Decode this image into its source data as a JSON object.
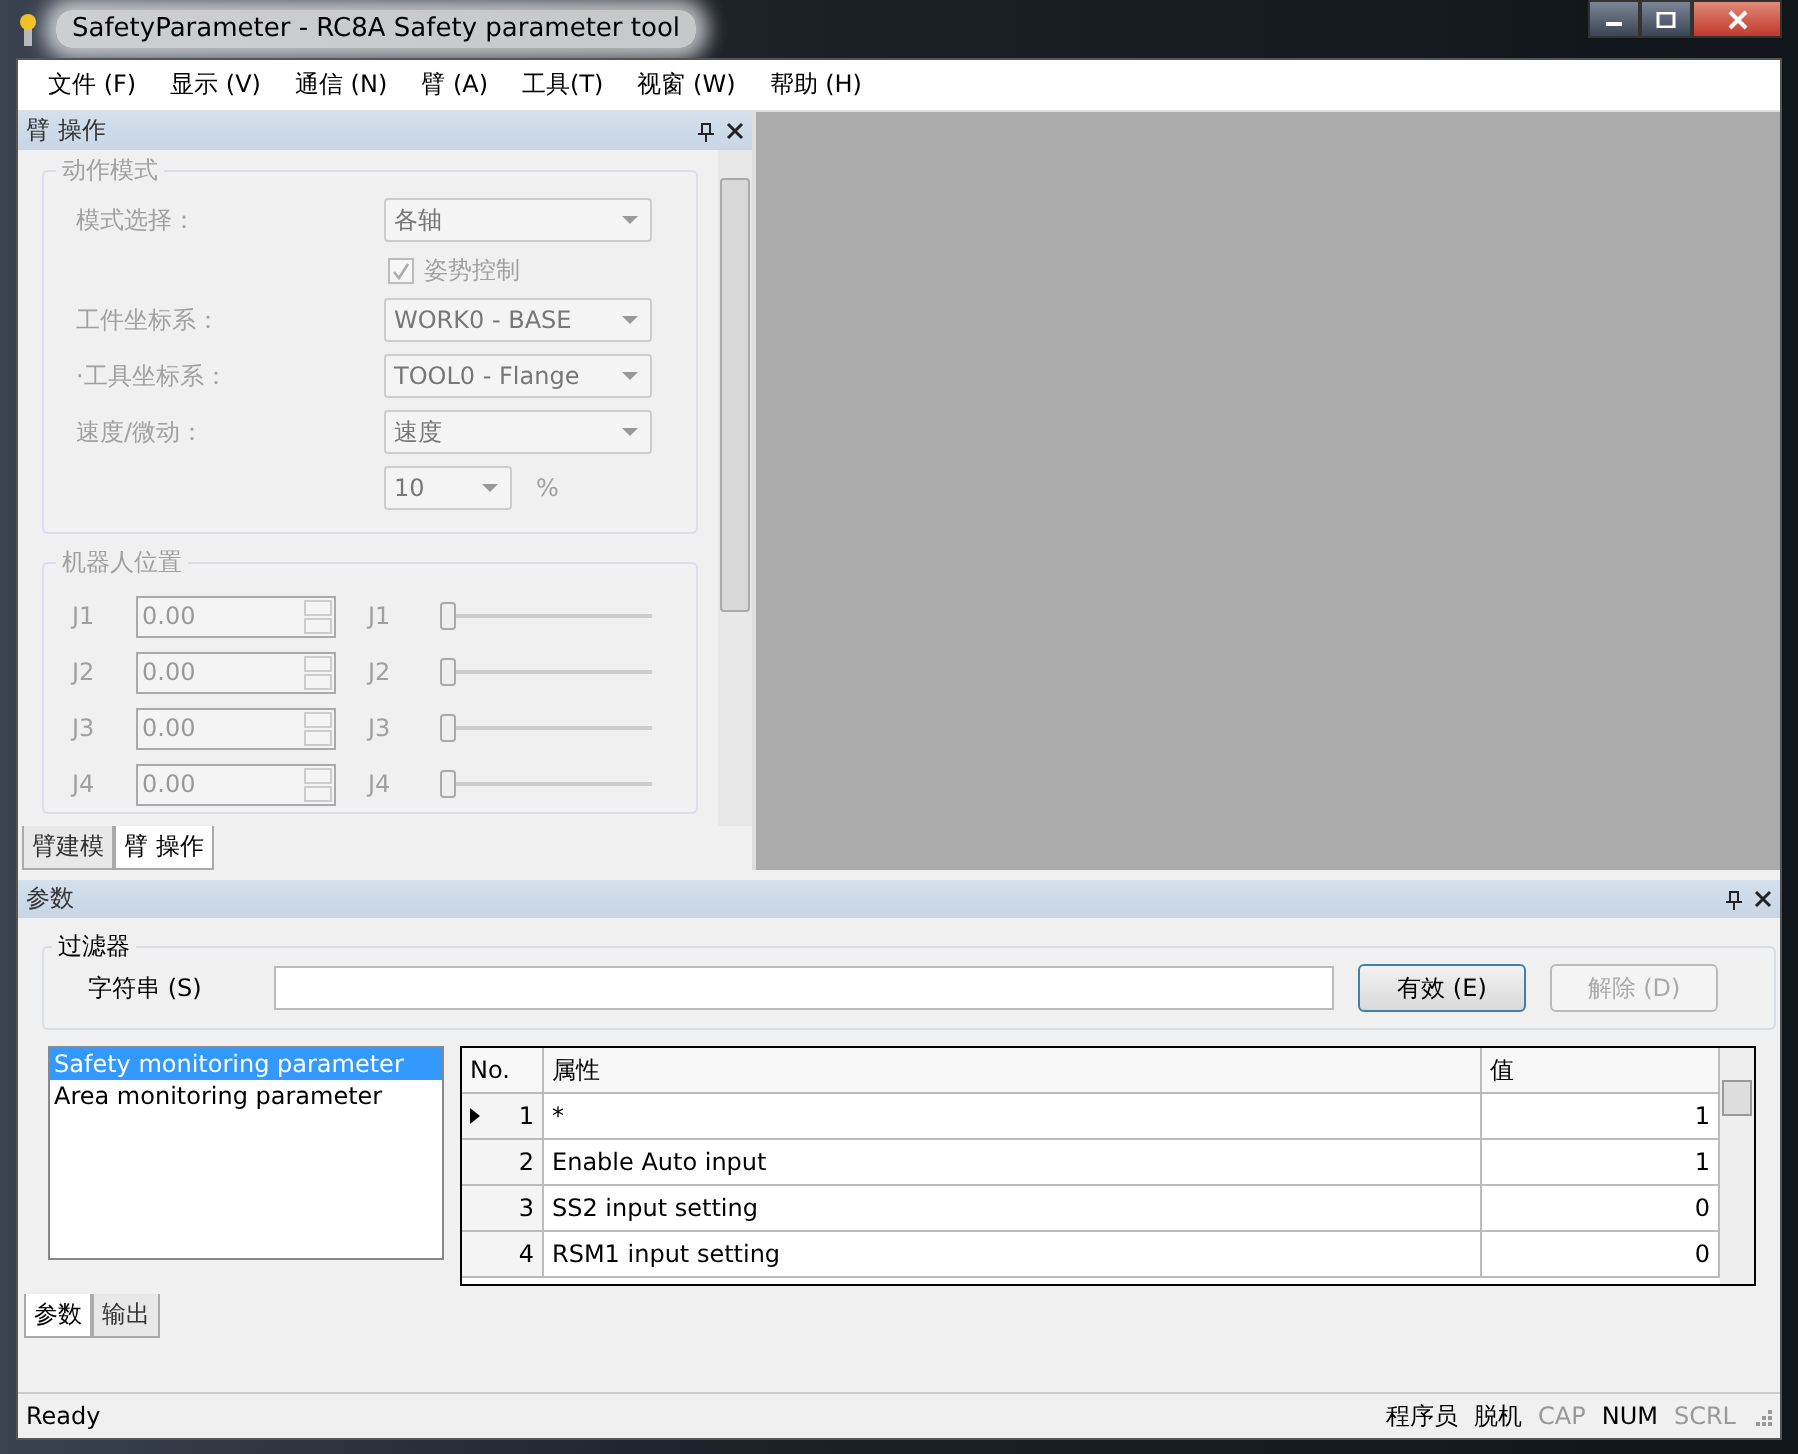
{
  "window": {
    "title": "SafetyParameter - RC8A Safety parameter tool"
  },
  "menu": [
    "文件 (F)",
    "显示 (V)",
    "通信 (N)",
    "臂 (A)",
    "工具(T)",
    "视窗 (W)",
    "帮助 (H)"
  ],
  "arm_panel": {
    "title": "臂 操作",
    "disabled": true,
    "motion_group": {
      "title": "动作模式",
      "fields": [
        {
          "kind": "dropdown",
          "label": "模式选择：",
          "value": "各轴"
        },
        {
          "kind": "checkbox",
          "label": "姿势控制",
          "checked": true
        },
        {
          "kind": "dropdown",
          "label": "工件坐标系：",
          "value": "WORK0 - BASE"
        },
        {
          "kind": "dropdown",
          "label": "·工具坐标系：",
          "value": "TOOL0 - Flange"
        },
        {
          "kind": "dropdown",
          "label": "速度/微动：",
          "value": "速度"
        },
        {
          "kind": "combo",
          "value": "10",
          "unit": "%"
        }
      ]
    },
    "position_group": {
      "title": "机器人位置",
      "joints": [
        {
          "label": "J1",
          "value": "0.00",
          "slider_label": "J1",
          "level": 0
        },
        {
          "label": "J2",
          "value": "0.00",
          "slider_label": "J2",
          "level": 0
        },
        {
          "label": "J3",
          "value": "0.00",
          "slider_label": "J3",
          "level": 0
        },
        {
          "label": "J4",
          "value": "0.00",
          "slider_label": "J4",
          "level": 0
        }
      ]
    },
    "tabs": [
      {
        "label": "臂建模",
        "selected": false
      },
      {
        "label": "臂 操作",
        "selected": true
      }
    ]
  },
  "param_panel": {
    "title": "参数",
    "filter": {
      "title": "过滤器",
      "label": "字符串 (S)",
      "apply": "有效 (E)",
      "clear": {
        "label": "解除 (D)",
        "disabled": true
      }
    },
    "categories": [
      {
        "label": "Safety monitoring parameter",
        "selected": true
      },
      {
        "label": "Area monitoring parameter",
        "selected": false
      }
    ],
    "table": {
      "columns": [
        "No.",
        "属性",
        "值"
      ],
      "rows": [
        {
          "no": "1",
          "property": "*",
          "value": "1",
          "current": true
        },
        {
          "no": "2",
          "property": "Enable Auto input",
          "value": "1",
          "current": false
        },
        {
          "no": "3",
          "property": "SS2 input setting",
          "value": "0",
          "current": false
        },
        {
          "no": "4",
          "property": "RSM1 input setting",
          "value": "0",
          "current": false
        }
      ]
    },
    "tabs": [
      {
        "label": "参数",
        "selected": true
      },
      {
        "label": "输出",
        "selected": false
      }
    ]
  },
  "status_bar": {
    "text": "Ready",
    "indicators": [
      {
        "label": "程序员",
        "on": true
      },
      {
        "label": "脱机",
        "on": true
      },
      {
        "label": "CAP",
        "on": false
      },
      {
        "label": "NUM",
        "on": true
      },
      {
        "label": "SCRL",
        "on": false
      }
    ]
  }
}
